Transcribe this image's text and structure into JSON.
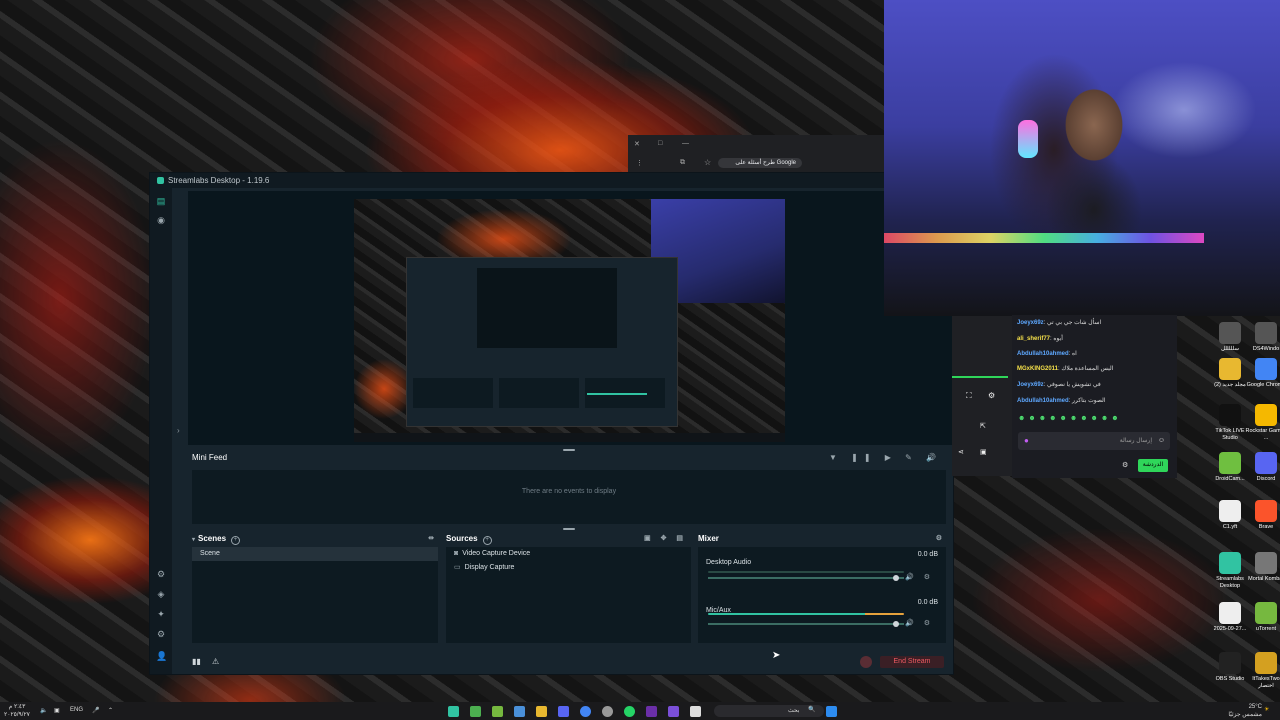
{
  "streamlabs": {
    "title": "Streamlabs Desktop - 1.19.6",
    "mini_feed": {
      "title": "Mini Feed",
      "empty_text": "There are no events to display"
    },
    "scenes": {
      "title": "Scenes",
      "items": [
        "Scene"
      ]
    },
    "sources": {
      "title": "Sources",
      "items": [
        "Video Capture Device",
        "Display Capture"
      ]
    },
    "mixer": {
      "title": "Mixer",
      "channels": [
        {
          "name": "Desktop Audio",
          "db": "0.0 dB",
          "level": 0.96
        },
        {
          "name": "Mic/Aux",
          "db": "0.0 dB",
          "level": 0.96
        }
      ]
    },
    "end_stream_label": "End Stream",
    "accent": "#31c3a2",
    "end_stream_color": "#f05a62"
  },
  "chrome": {
    "address_text": "طرح أسئلة على Google"
  },
  "chat": {
    "messages": [
      {
        "user": "Joeyx69z",
        "user_color": "#5ea8ff",
        "text": "اسأل شات جي بي تي"
      },
      {
        "user": "ali_sherif77",
        "user_color": "#f5e04a",
        "text": "أيوه"
      },
      {
        "user": "Abdullah10ahmed",
        "user_color": "#5ea8ff",
        "text": "اه"
      },
      {
        "user": "MGxKING2011",
        "user_color": "#f5e04a",
        "text": "اليس المساعدة ملاك"
      },
      {
        "user": "Joeyx69z",
        "user_color": "#5ea8ff",
        "text": "في تشويش يا نصوفي"
      },
      {
        "user": "Abdullah10ahmed",
        "user_color": "#5ea8ff",
        "text": "الصوت بتاكرر"
      }
    ],
    "input_placeholder": "إرسال رسالة",
    "send_label": "الدردشة",
    "emote_color": "#4de070"
  },
  "desktop_icons": [
    {
      "label": "سلللللل",
      "color": "#555"
    },
    {
      "label": "DS4Windo",
      "color": "#555"
    },
    {
      "label": "مجلد جديد (2)",
      "color": "#e8b830"
    },
    {
      "label": "Google Chrome",
      "color": "#4285f4"
    },
    {
      "label": "TikTok LIVE Studio",
      "color": "#111"
    },
    {
      "label": "Rockstar Games ...",
      "color": "#f5b800"
    },
    {
      "label": "DroidCam...",
      "color": "#6fbf40"
    },
    {
      "label": "Discord",
      "color": "#5865f2"
    },
    {
      "label": "C1.yft",
      "color": "#eee"
    },
    {
      "label": "Brave",
      "color": "#fb542b"
    },
    {
      "label": "Streamlabs Desktop",
      "color": "#31c3a2"
    },
    {
      "label": "Mortal Kombat",
      "color": "#777"
    },
    {
      "label": "2025-09-27...",
      "color": "#eee"
    },
    {
      "label": "uTorrent",
      "color": "#76b83f"
    },
    {
      "label": "OBS Studio",
      "color": "#222"
    },
    {
      "label": "ItTakesTwo اختصار",
      "color": "#d4a020"
    }
  ],
  "taskbar": {
    "language": "ENG",
    "time": "٢:٤٣ م",
    "date": "٢٠٢٥/٩/٢٧",
    "weather": "25°C",
    "weather_desc": "مشمس جزئيًا",
    "search_placeholder": "بحث"
  }
}
